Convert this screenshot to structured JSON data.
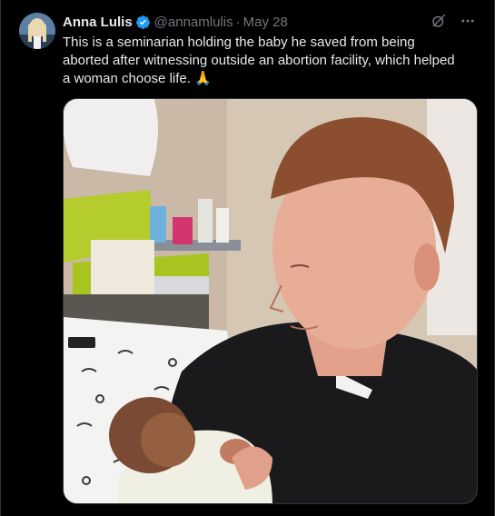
{
  "author": {
    "name": "Anna Lulis",
    "handle": "@annamlulis",
    "separator": "·",
    "date": "May 28",
    "verified_color": "#1d9bf0"
  },
  "icons": {
    "verified": "verified-badge-icon",
    "grok": "grok-icon",
    "more": "more-options-icon"
  },
  "tweet": {
    "text": "This is a seminarian holding the baby he saved from being aborted after witnessing outside an abortion facility, which helped a woman choose life. 🙏"
  },
  "colors": {
    "background": "#000000",
    "text_primary": "#e7e9ea",
    "text_secondary": "#71767b",
    "border": "#2f3336"
  }
}
